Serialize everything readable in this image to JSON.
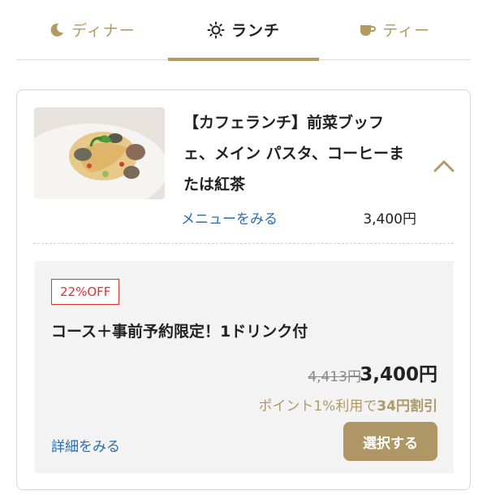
{
  "tabs": [
    {
      "label": "ディナー",
      "icon": "moon-icon",
      "active": false
    },
    {
      "label": "ランチ",
      "icon": "sun-icon",
      "active": true
    },
    {
      "label": "ティー",
      "icon": "teacup-icon",
      "active": false
    }
  ],
  "course": {
    "title_line1": "【カフェランチ】前菜ブッフ",
    "title_line2": "ェ、メイン パスタ、コーヒーま",
    "title_line3": "たは紅茶",
    "menu_link": "メニューをみる",
    "price": "3,400円"
  },
  "plan": {
    "badge": "22%OFF",
    "title": "コース＋事前予約限定！1ドリンク付",
    "original_price": "4,413円",
    "price": "3,400円",
    "points_prefix": "ポイント1%利用で",
    "points_amount": "34円割引",
    "detail_link": "詳細をみる",
    "select_button": "選択する"
  },
  "colors": {
    "accent_gold": "#b29b62",
    "link_blue": "#2b6cb0",
    "badge_red": "#e03131"
  }
}
